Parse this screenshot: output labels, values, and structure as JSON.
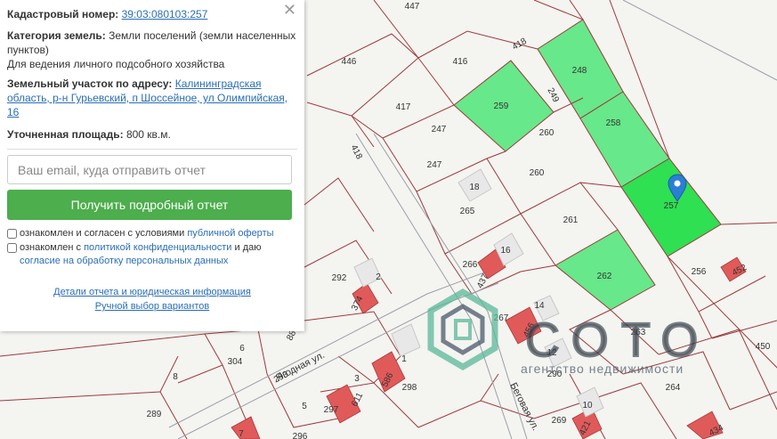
{
  "map": {
    "parcel_labels": [
      "447",
      "446",
      "416",
      "418",
      "248",
      "249",
      "417",
      "259",
      "247",
      "260",
      "258",
      "418",
      "247",
      "260",
      "18",
      "265",
      "257",
      "261",
      "16",
      "266",
      "437",
      "292",
      "2",
      "374",
      "262",
      "256",
      "452",
      "14",
      "267",
      "456",
      "12",
      "450",
      "263",
      "6",
      "304",
      "8",
      "1",
      "3",
      "586",
      "298",
      "611",
      "297",
      "290",
      "264",
      "289",
      "5",
      "10",
      "269",
      "421",
      "434",
      "7",
      "296",
      "88",
      "293"
    ],
    "street_labels": [
      "Ягодная ул.",
      "Беговая ул."
    ],
    "highlight_color": "#67e88a",
    "marker_color": "#2a7fd4",
    "building_color": "#e05a5a"
  },
  "panel": {
    "close_label": "✕",
    "cadastral_label": "Кадастровый номер:",
    "cadastral_value": "39:03:080103:257",
    "category_label": "Категория земель:",
    "category_value": "Земли поселений (земли населенных пунктов)",
    "usage_value": "Для ведения личного подсобного хозяйства",
    "address_label": "Земельный участок по адресу:",
    "address_value": "Калининградская область, р-н Гурьевский, п Шоссейное, ул Олимпийская, 16",
    "area_label": "Уточненная площадь:",
    "area_value": "800 кв.м.",
    "email_placeholder": "Ваш email, куда отправить отчет",
    "submit_label": "Получить подробный отчет",
    "terms_prefix": "ознакомлен и согласен с условиями",
    "terms_link": "публичной оферты",
    "privacy_prefix": "ознакомлен с",
    "privacy_link": "политикой конфиденциальности",
    "privacy_mid": "и даю",
    "consent_link": "согласие на обработку персональных данных",
    "details_link": "Детали отчета и юридическая информация",
    "manual_link": "Ручной выбор вариантов"
  },
  "watermark": {
    "brand": "СОТО",
    "tagline": "агентство недвижимости"
  }
}
